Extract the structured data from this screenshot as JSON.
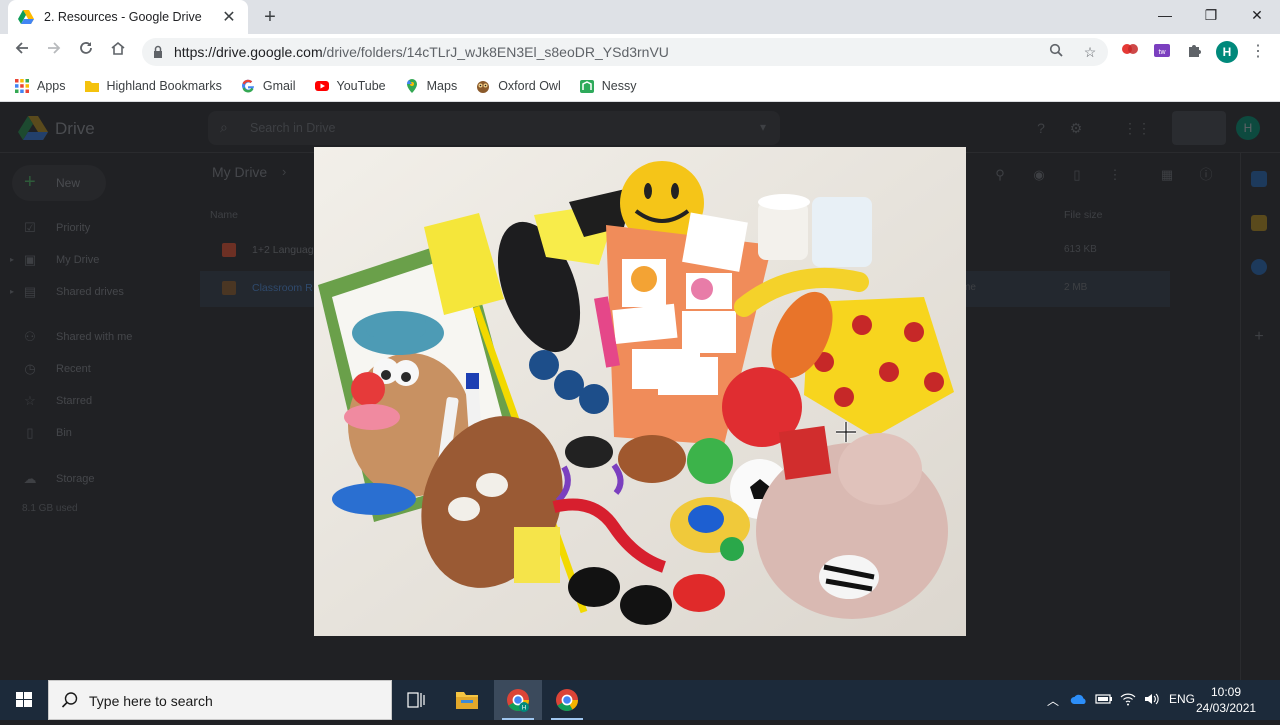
{
  "browser": {
    "tab": {
      "title": "2. Resources - Google Drive",
      "close_label": "✕"
    },
    "new_tab_label": "+",
    "window_controls": {
      "minimize": "—",
      "restore": "❐",
      "close": "✕"
    },
    "url": {
      "host": "https://drive.google.com",
      "path": "/drive/folders/14cTLrJ_wJk8EN3El_s8eoDR_YSd3rnVU"
    },
    "profile_initial": "H",
    "bookmarks": [
      {
        "label": "Apps",
        "icon": "apps-grid-icon",
        "color": "#ea4335"
      },
      {
        "label": "Highland Bookmarks",
        "icon": "folder-icon",
        "color": "#f4c20d"
      },
      {
        "label": "Gmail",
        "icon": "google-g-icon",
        "color": "#4285f4"
      },
      {
        "label": "YouTube",
        "icon": "youtube-icon",
        "color": "#ff0000"
      },
      {
        "label": "Maps",
        "icon": "maps-pin-icon",
        "color": "#34a853"
      },
      {
        "label": "Oxford Owl",
        "icon": "owl-icon",
        "color": "#8b5a2b"
      },
      {
        "label": "Nessy",
        "icon": "nessy-icon",
        "color": "#2eaa5b"
      }
    ]
  },
  "drive": {
    "app_name": "Drive",
    "search_placeholder": "Search in Drive",
    "new_label": "New",
    "nav": [
      {
        "label": "Priority",
        "icon": "check-circle-icon"
      },
      {
        "label": "My Drive",
        "icon": "my-drive-icon"
      },
      {
        "label": "Shared drives",
        "icon": "shared-drives-icon"
      },
      {
        "label": "Shared with me",
        "icon": "people-icon"
      },
      {
        "label": "Recent",
        "icon": "clock-icon"
      },
      {
        "label": "Starred",
        "icon": "star-icon"
      },
      {
        "label": "Bin",
        "icon": "bin-icon"
      },
      {
        "label": "Storage",
        "icon": "cloud-icon"
      }
    ],
    "storage_used": "8.1 GB used",
    "breadcrumb": "My Drive",
    "columns": {
      "name": "Name",
      "size": "File size"
    },
    "files": [
      {
        "name": "1+2 Language",
        "size": "613 KB",
        "extra": "",
        "color": "#b5533c"
      },
      {
        "name": "Classroom R",
        "size": "2 MB",
        "extra": "me",
        "color": "#6b4a2a"
      }
    ]
  },
  "taskbar": {
    "search_placeholder": "Type here to search",
    "language": "ENG",
    "time": "10:09",
    "date": "24/03/2021"
  }
}
